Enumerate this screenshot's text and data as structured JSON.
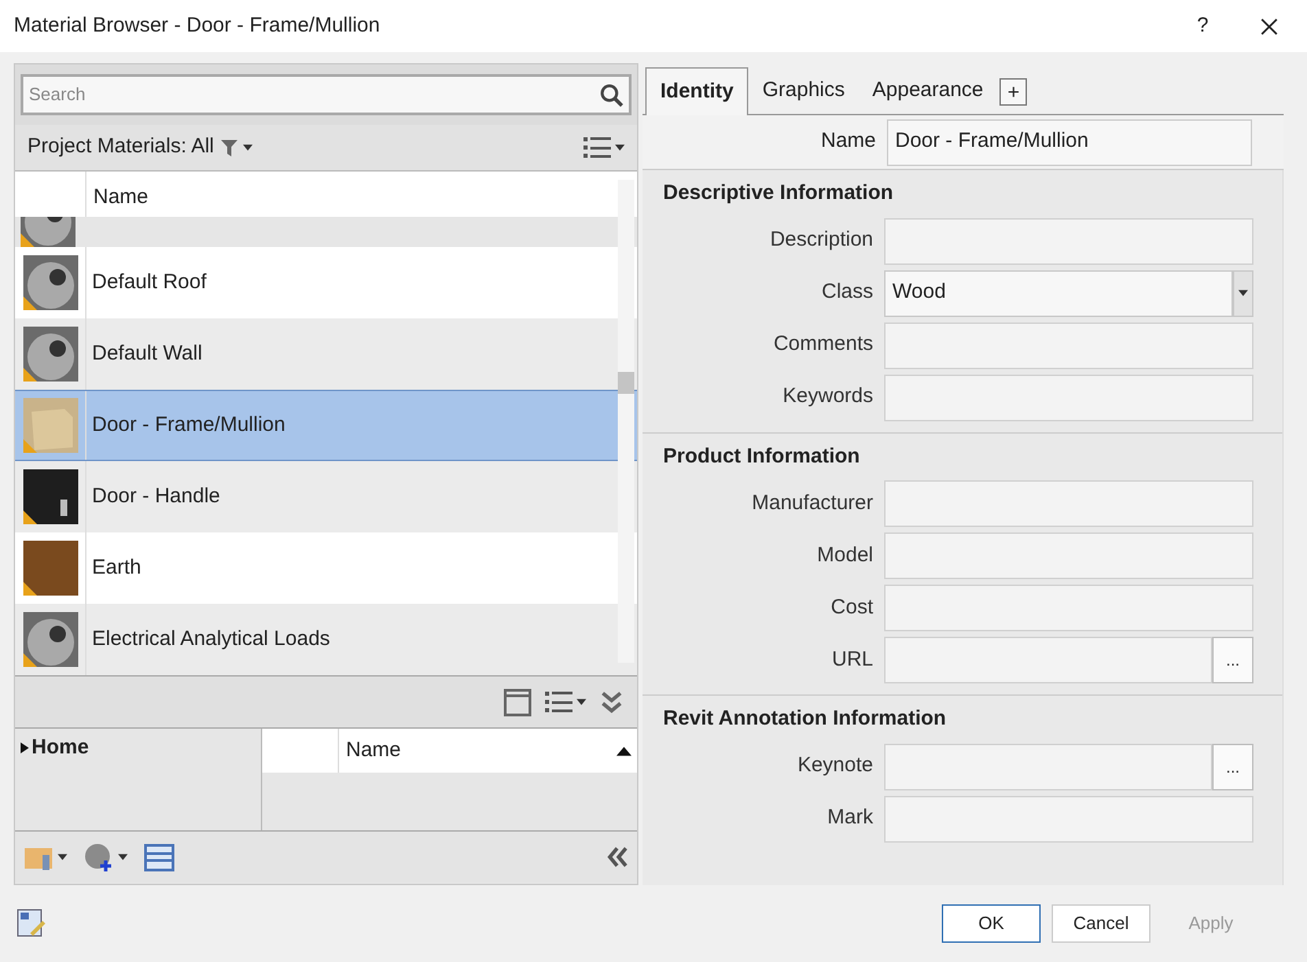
{
  "window": {
    "title": "Material Browser - Door - Frame/Mullion",
    "help": "?"
  },
  "search": {
    "placeholder": "Search"
  },
  "filter": {
    "label": "Project Materials: All"
  },
  "list": {
    "column": "Name",
    "partial_row": {
      "kind": "sphere"
    },
    "rows": [
      {
        "name": "Default Roof",
        "kind": "sphere",
        "selected": false
      },
      {
        "name": "Default Wall",
        "kind": "sphere",
        "selected": false
      },
      {
        "name": "Door - Frame/Mullion",
        "kind": "cube",
        "selected": true
      },
      {
        "name": "Door - Handle",
        "kind": "dark",
        "selected": false
      },
      {
        "name": "Earth",
        "kind": "earth",
        "selected": false
      },
      {
        "name": "Electrical Analytical Loads",
        "kind": "sphere",
        "selected": false
      }
    ]
  },
  "library": {
    "tree": [
      {
        "label": "Home",
        "expanded": false
      }
    ],
    "column": "Name"
  },
  "tabs": [
    {
      "label": "Identity",
      "selected": true
    },
    {
      "label": "Graphics",
      "selected": false
    },
    {
      "label": "Appearance",
      "selected": false
    }
  ],
  "add_tab": "+",
  "name_field": {
    "label": "Name",
    "value": "Door - Frame/Mullion"
  },
  "sections": [
    {
      "title": "Descriptive Information",
      "fields": [
        {
          "label": "Description",
          "kind": "text"
        },
        {
          "label": "Class",
          "kind": "dropdown",
          "value": "Wood"
        },
        {
          "label": "Comments",
          "kind": "text"
        },
        {
          "label": "Keywords",
          "kind": "text"
        }
      ]
    },
    {
      "title": "Product Information",
      "fields": [
        {
          "label": "Manufacturer",
          "kind": "text"
        },
        {
          "label": "Model",
          "kind": "text"
        },
        {
          "label": "Cost",
          "kind": "text"
        },
        {
          "label": "URL",
          "kind": "browse",
          "browse": "..."
        }
      ]
    },
    {
      "title": "Revit Annotation Information",
      "fields": [
        {
          "label": "Keynote",
          "kind": "browse",
          "browse": "..."
        },
        {
          "label": "Mark",
          "kind": "text"
        }
      ]
    }
  ],
  "buttons": [
    {
      "label": "OK",
      "disabled": false,
      "default": true
    },
    {
      "label": "Cancel",
      "disabled": false,
      "default": false
    },
    {
      "label": "Apply",
      "disabled": true,
      "default": false
    }
  ]
}
